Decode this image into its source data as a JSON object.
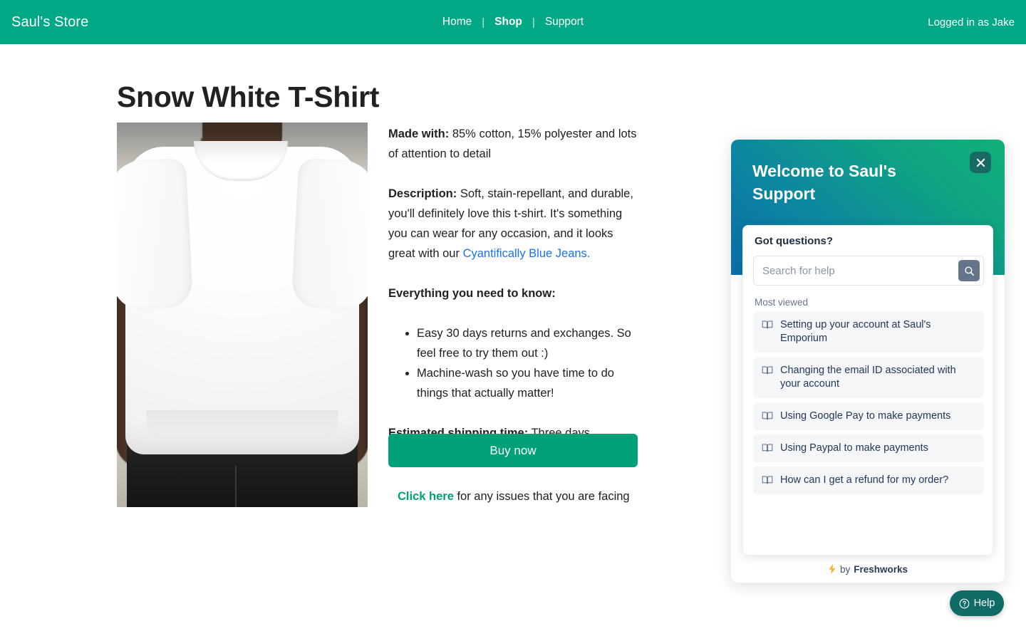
{
  "nav": {
    "brand": "Saul's Store",
    "links": [
      {
        "label": "Home",
        "active": false
      },
      {
        "label": "Shop",
        "active": true
      },
      {
        "label": "Support",
        "active": false
      }
    ],
    "separator": "|",
    "login_state": "Logged in as Jake"
  },
  "product": {
    "title": "Snow White T-Shirt",
    "image_alt": "Person wearing a white crew-neck t-shirt",
    "made_with_label": "Made with:",
    "made_with_text": " 85% cotton, 15% polyester and lots of attention to detail",
    "description_label": "Description:",
    "description_text": " Soft, stain-repellant, and durable, you'll definitely love this t-shirt. It's something you can wear for any occasion, and it looks great with our ",
    "description_link": "Cyantifically Blue Jeans.",
    "everything_label": "Everything you need to know:",
    "bullets": [
      "Easy 30 days returns and exchanges. So feel free to try them out :)",
      "Machine-wash so you have time to do things that actually matter!"
    ],
    "shipping_label": "Estimated shipping time:",
    "shipping_text": " Three days",
    "buy_button": "Buy now",
    "issues_link": "Click here",
    "issues_text": " for any issues that you are facing"
  },
  "widget": {
    "title": "Welcome to Saul's Support",
    "close_label": "Close",
    "got_questions": "Got questions?",
    "search_placeholder": "Search for help",
    "search_value": "",
    "most_viewed": "Most viewed",
    "articles": [
      "Setting up your account at Saul's Emporium",
      "Changing the email ID associated with your account",
      "Using Google Pay to make payments",
      "Using Paypal to make payments",
      "How can I get a refund for my order?"
    ],
    "footer_by": "by",
    "footer_brand": "Freshworks"
  },
  "launcher": {
    "label": "Help"
  },
  "colors": {
    "brand_green": "#00a886",
    "buy_button": "#00a179",
    "link_blue": "#1a73e8",
    "widget_gradient_start": "#0a6ea6",
    "widget_gradient_end": "#12b07a",
    "close_button": "#176b62",
    "search_button": "#64748b",
    "article_bg": "#f4f6f8",
    "launcher": "#0e6b66",
    "bolt": "#f7b32b"
  }
}
